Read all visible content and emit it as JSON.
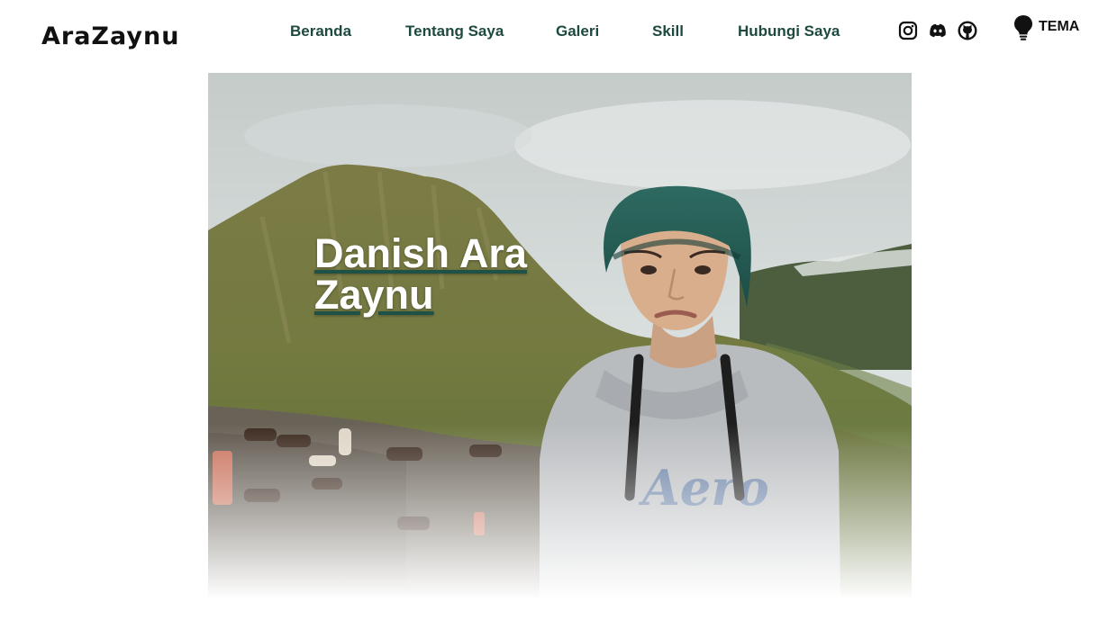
{
  "brand": {
    "logo_text": "AraZaynu"
  },
  "nav": {
    "items": [
      {
        "label": "Beranda"
      },
      {
        "label": "Tentang Saya"
      },
      {
        "label": "Galeri"
      },
      {
        "label": "Skill"
      },
      {
        "label": "Hubungi Saya"
      }
    ]
  },
  "social": {
    "icons": [
      "instagram-icon",
      "discord-icon",
      "github-icon"
    ]
  },
  "theme": {
    "label": "TEMA",
    "icon": "lightbulb-icon"
  },
  "hero": {
    "title": "Danish Ara Zaynu"
  },
  "colors": {
    "nav_text": "#1d4a40",
    "accent_underline": "#1f5246",
    "background": "#ffffff"
  }
}
